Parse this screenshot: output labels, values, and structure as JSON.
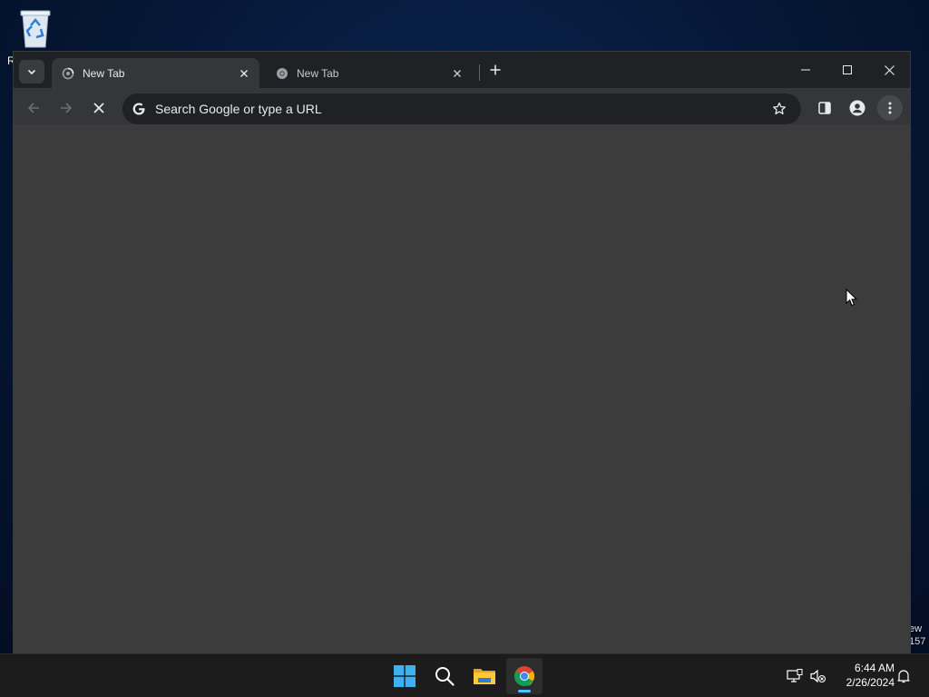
{
  "desktop": {
    "recycle_bin_label": "R",
    "side_text_line1": "ew",
    "side_text_line2": "157"
  },
  "browser": {
    "tabs": [
      {
        "label": "New Tab",
        "state": "loading",
        "active": true
      },
      {
        "label": "New Tab",
        "state": "idle",
        "active": false
      }
    ],
    "omnibox": {
      "placeholder": "Search Google or type a URL",
      "value": ""
    },
    "icons": {
      "tab_search": "chevron-down-icon",
      "new_tab": "plus-icon",
      "minimize": "minimize-icon",
      "maximize": "maximize-icon",
      "close": "close-icon",
      "back": "arrow-left-icon",
      "forward": "arrow-right-icon",
      "stop": "stop-icon",
      "bookmark": "star-icon",
      "side_panel": "side-panel-icon",
      "profile": "profile-icon",
      "menu": "more-vert-icon"
    },
    "colors": {
      "frame": "#202124",
      "toolbar": "#35363a",
      "content": "#3c3c3c",
      "omnibox": "#202124"
    }
  },
  "taskbar": {
    "apps": [
      "start",
      "search",
      "file-explorer",
      "chrome"
    ],
    "active_app": "chrome",
    "clock": {
      "time": "6:44 AM",
      "date": "2/26/2024"
    },
    "colors": {
      "background": "#1c1c1c",
      "indicator": "#4cc2ff"
    }
  }
}
